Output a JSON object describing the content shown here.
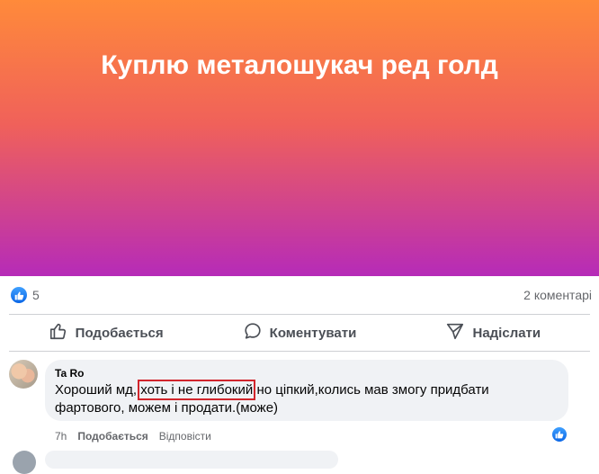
{
  "post": {
    "banner_text": "Куплю металошукач ред голд",
    "banner_colors": [
      "#ff8a3a",
      "#f0615a",
      "#b62bb8"
    ]
  },
  "stats": {
    "likes": "5",
    "comments": "2 коментарі"
  },
  "actions": {
    "like_label": "Подобається",
    "comment_label": "Коментувати",
    "share_label": "Надіслати"
  },
  "comment": {
    "author": "Ta Ro",
    "text_before": "Хороший мд,",
    "text_highlight": "хоть і не глибокий",
    "text_after": "но ціпкий,колись мав змогу придбати фартового, можем і продати.(може)",
    "time": "7h",
    "like_label": "Подобається",
    "reply_label": "Відповісти"
  },
  "colors": {
    "accent": "#0a66e6",
    "highlight_border": "#d1252c",
    "bubble_bg": "#f0f2f5"
  },
  "icons": {
    "like_badge": "thumbs-up-icon",
    "like_action": "thumbs-up-outline-icon",
    "comment_action": "speech-bubble-icon",
    "share_action": "send-icon"
  }
}
